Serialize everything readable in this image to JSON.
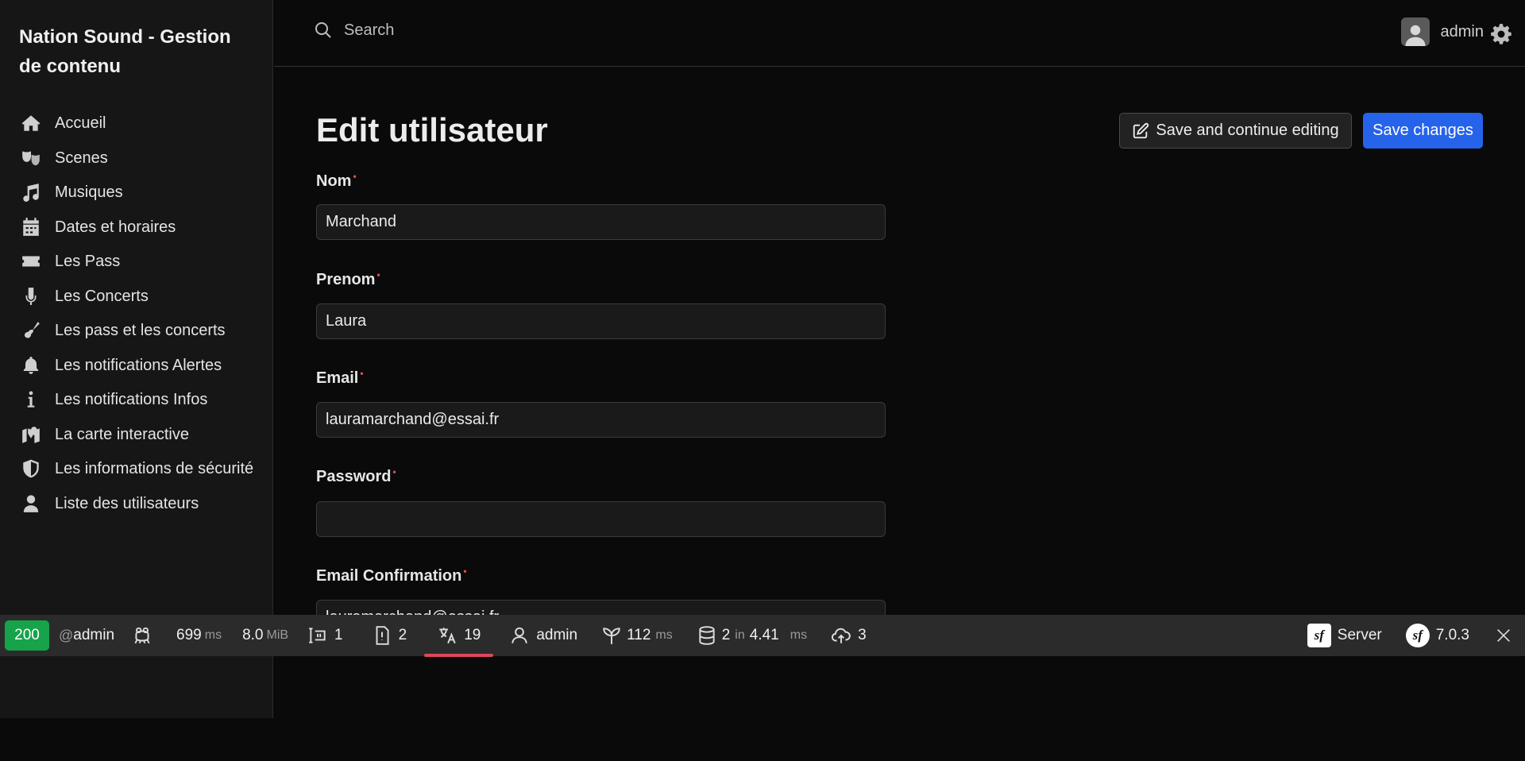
{
  "brand": {
    "title": "Nation Sound - Gestion de contenu"
  },
  "sidebar": {
    "items": [
      {
        "label": "Accueil",
        "icon": "home-icon"
      },
      {
        "label": "Scenes",
        "icon": "theater-masks-icon"
      },
      {
        "label": "Musiques",
        "icon": "music-note-icon"
      },
      {
        "label": "Dates et horaires",
        "icon": "calendar-icon"
      },
      {
        "label": "Les Pass",
        "icon": "ticket-icon"
      },
      {
        "label": "Les Concerts",
        "icon": "microphone-icon"
      },
      {
        "label": "Les pass et les concerts",
        "icon": "guitar-icon"
      },
      {
        "label": "Les notifications Alertes",
        "icon": "bell-icon"
      },
      {
        "label": "Les notifications Infos",
        "icon": "info-icon"
      },
      {
        "label": "La carte interactive",
        "icon": "map-icon"
      },
      {
        "label": "Les informations de sécurité",
        "icon": "shield-icon"
      },
      {
        "label": "Liste des utilisateurs",
        "icon": "user-icon"
      }
    ]
  },
  "header": {
    "search_placeholder": "Search",
    "username": "admin"
  },
  "main": {
    "title": "Edit utilisateur",
    "save_continue_label": "Save and continue editing",
    "save_label": "Save changes",
    "fields": [
      {
        "label": "Nom",
        "value": "Marchand",
        "required": "•"
      },
      {
        "label": "Prenom",
        "value": "Laura",
        "required": "•"
      },
      {
        "label": "Email",
        "value": "lauramarchand@essai.fr",
        "required": "•"
      },
      {
        "label": "Password",
        "value": "",
        "required": "•"
      },
      {
        "label": "Email Confirmation",
        "value": "lauramarchand@essai.fr",
        "required": "•"
      }
    ]
  },
  "debugbar": {
    "status": "200",
    "route_prefix": "@",
    "route": "admin",
    "time_value": "699",
    "time_unit": "ms",
    "memory_value": "8.0",
    "memory_unit": "MiB",
    "forms": "1",
    "logs": "2",
    "translations": "19",
    "user": "admin",
    "twig_value": "112",
    "twig_unit": "ms",
    "db_queries": "2",
    "db_in": "in",
    "db_time": "4.41",
    "db_unit": "ms",
    "http_calls": "3",
    "server_label": "Server",
    "symfony_version": "7.0.3"
  },
  "colors": {
    "primary": "#2563eb",
    "status_ok": "#16a34a",
    "required": "#e24c4b",
    "active_tab": "#e0465e"
  }
}
